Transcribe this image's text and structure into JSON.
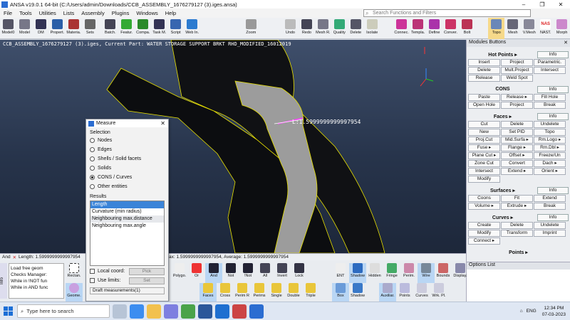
{
  "window": {
    "title": "ANSA v19.0.1 64-bit (C:/Users/admin/Downloads/CCB_ASSEMBLY_1676279127 (3).iges.ansa)",
    "min": "–",
    "max": "❐",
    "close": "✕"
  },
  "menu": [
    "File",
    "Tools",
    "Utilities",
    "Lists",
    "Assembly",
    "Plugins",
    "Windows",
    "Help"
  ],
  "search": {
    "placeholder": "Search Functions and Filters"
  },
  "toolbar": [
    "Model0",
    "Model",
    "DM",
    "Propert.",
    "Materia.",
    "Sets",
    "Batch.",
    "Featur.",
    "Compa.",
    "Task M.",
    "Script",
    "Web In.",
    "Zoom",
    "Undo",
    "Redo",
    "Mesh R.",
    "Quality",
    "Delete",
    "Isolate",
    "Connec.",
    "Templa.",
    "Define",
    "Conver.",
    "Bolt",
    "Topo",
    "Mesh",
    "V.Mesh",
    "NAST.",
    "Morph"
  ],
  "toolbar_badge": "NAS",
  "viewport": {
    "header": "CCB_ASSEMBLY_1676279127 (3).iges,  Current Part: WATER STORAGE SUPPORT BRKT RHD_MODIFIED_16012019",
    "measure_label": "L:1.5999999999997954"
  },
  "panel": {
    "title": "Modules Buttons",
    "close": "✕",
    "groups": [
      {
        "name": "Hot Points ▸",
        "info": "Info",
        "buttons": [
          "Insert",
          "Project",
          "Parametric.",
          "Delete",
          "Mult.Project",
          "Intersect",
          "Release",
          "Weld Spot"
        ]
      },
      {
        "name": "CONS",
        "info": "Info",
        "buttons": [
          "Paste",
          "Release ▸",
          "Fill Hole",
          "Open Hole",
          "Project",
          "Break"
        ]
      },
      {
        "name": "Faces ▸",
        "info": "Info",
        "buttons": [
          "Cut",
          "Delete",
          "Undelete",
          "New",
          "Set PID",
          "Topo",
          "Proj.Cut",
          "Mid.Surfa ▸",
          "Rm.Logo ▸",
          "Fuse ▸",
          "Flange ▸",
          "Rm.Dbl ▸",
          "Plane Cut ▸",
          "Offset ▸",
          "Freeze/Un",
          "Zone Cut",
          "Convert",
          "Dach ▸",
          "Intersect",
          "Extend ▸",
          "Orient ▸",
          "Modify"
        ]
      },
      {
        "name": "Surfaces ▸",
        "info": "Info",
        "buttons": [
          "Coons",
          "Fit",
          "Extend",
          "Volume ▸",
          "Extrude ▸",
          "Break"
        ]
      },
      {
        "name": "Curves ▸",
        "info": "Info",
        "buttons": [
          "Create",
          "Delete",
          "Undelete",
          "Modify",
          "Transform",
          "Imprint",
          "Connect ▸"
        ]
      },
      {
        "name": "Points ▸",
        "info": "",
        "buttons": []
      }
    ]
  },
  "options": {
    "title": "Options List"
  },
  "statusbar": {
    "left": "And",
    "text": "Length: 1.5999999999997954, Min: 1.5999999999997954, Max: 1.5999999999997954, Average: 1.5999999999997954",
    "text_visible": "Length: 1.5999999999997954",
    "text_right": "ax: 1.5999999999997954, Average: 1.5999999999997954"
  },
  "messages": [
    "Load free geom",
    "Checks Manager:",
    "While in !NOT fun",
    "While in AND func"
  ],
  "info_tab": "Info",
  "bottom_toolbar": [
    "Rectan.",
    "Geome.",
    "Polygo.",
    "Or",
    "And",
    "Not",
    "!Not",
    "All",
    "Invert",
    "Lock",
    "Faces",
    "Cross",
    "Perim R",
    "Perims",
    "Single",
    "Double",
    "Triple",
    "ENT",
    "Shadow",
    "Hidden",
    "Fringe",
    "Perim.",
    "Wire",
    "Bounds",
    "Display.",
    "Box",
    "Shadow",
    "Auxiliar.",
    "Points",
    "Curves",
    "Wrk. Pl."
  ],
  "measure": {
    "title": "Measure",
    "close": "✕",
    "selection_label": "Selection",
    "selection": [
      "Nodes",
      "Edges",
      "Shells / Solid facets",
      "Solids",
      "CONS / Curves",
      "Other entities"
    ],
    "selected_index": 4,
    "results_label": "Results",
    "results": [
      "Length",
      "Curvature (min radius)",
      "Neighbouring max.distance",
      "Neighbouring max.angle"
    ],
    "local_coord": "Local coord:",
    "pick": "Pick",
    "use_limits": "Use limits:",
    "set": "Set",
    "draft": "Draft measurements(1)"
  },
  "taskbar": {
    "search": "Type here to search",
    "lang": "ENG",
    "time": "12:34 PM",
    "date": "07-03-2023"
  }
}
